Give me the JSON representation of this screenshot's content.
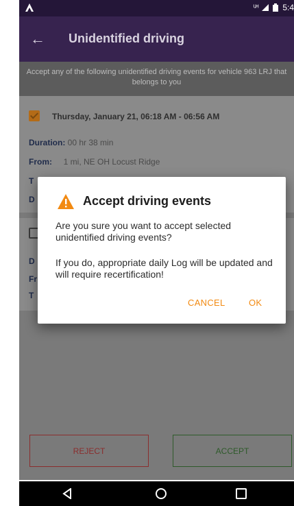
{
  "status_bar": {
    "left_icon": "notification-a-icon",
    "signal_text": "ᵁᴴ",
    "battery_icon": "battery-icon",
    "time": "5:4"
  },
  "app_bar": {
    "back_icon": "back-arrow-icon",
    "title": "Unidentified driving"
  },
  "subheader": {
    "text": "Accept any of the following unidentified driving events for vehicle 963 LRJ that belongs to you"
  },
  "events": [
    {
      "checked": true,
      "date": "Thursday, January 21, 06:18 AM - 06:56 AM",
      "duration_label": "Duration:",
      "duration_value": "00 hr 38 min",
      "from_label": "From:",
      "from_value": "1 mi, NE OH Locust Ridge",
      "to_label_partial": "T",
      "dist_label_partial": "D"
    },
    {
      "checked": false,
      "dist_label_partial": "D",
      "from_label_partial": "Fr",
      "to_label_partial": "T"
    }
  ],
  "buttons": {
    "reject": "REJECT",
    "accept": "ACCEPT"
  },
  "dialog": {
    "icon": "warning-icon",
    "title": "Accept driving events",
    "text1": "Are you sure you want to accept selected unidentified driving events?",
    "text2": "If you do, appropriate daily Log will be updated and will require recertification!",
    "cancel": "CANCEL",
    "ok": "OK"
  },
  "colors": {
    "app_bar": "#37234f",
    "dialog_accent": "#f28a12",
    "reject": "#8a2d2d",
    "accept": "#2e5a2a"
  }
}
